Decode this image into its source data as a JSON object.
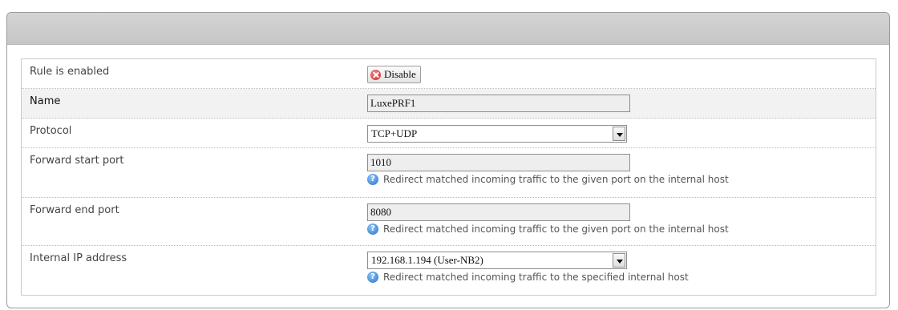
{
  "form": {
    "rows": [
      {
        "label": "Rule is enabled",
        "button_label": "Disable",
        "button_icon": "x-icon"
      },
      {
        "label": "Name",
        "value": "LuxePRF1"
      },
      {
        "label": "Protocol",
        "value": "TCP+UDP"
      },
      {
        "label": "Forward start port",
        "value": "1010",
        "hint": "Redirect matched incoming traffic to the given port on the internal host"
      },
      {
        "label": "Forward end port",
        "value": "8080",
        "hint": "Redirect matched incoming traffic to the given port on the internal host"
      },
      {
        "label": "Internal IP address",
        "value": "192.168.1.194 (User-NB2)",
        "hint": "Redirect matched incoming traffic to the specified internal host"
      }
    ]
  },
  "colors": {
    "header_bar": "#c6c6c6",
    "input_background": "#eeeeee",
    "disable_icon": "#c82424",
    "help_icon": "#2a6fc4"
  }
}
